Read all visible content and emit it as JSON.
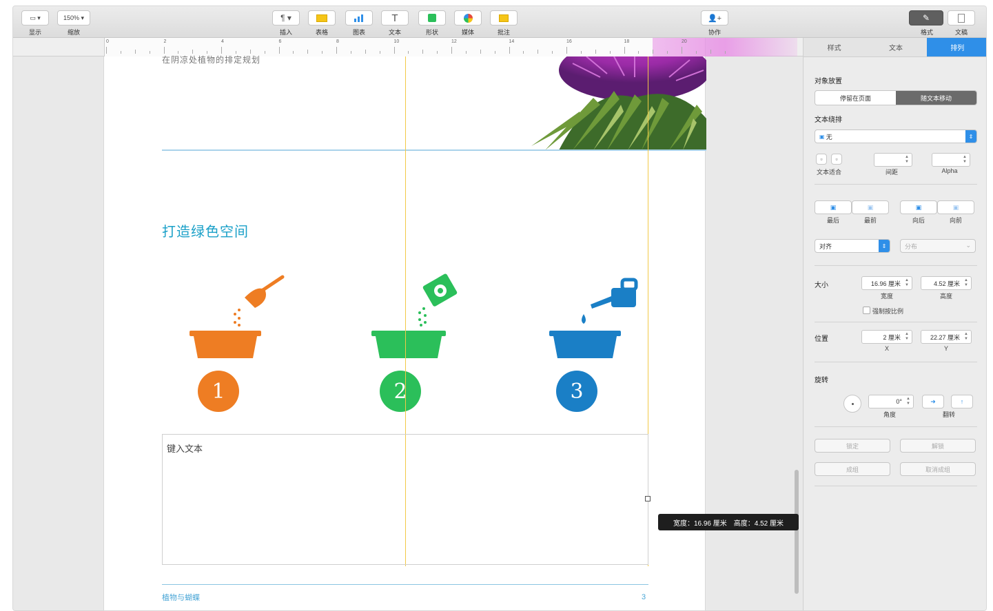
{
  "toolbar": {
    "view_label": "显示",
    "zoom_value": "150%",
    "zoom_label": "缩放",
    "insert_label": "插入",
    "table_label": "表格",
    "chart_label": "图表",
    "text_label": "文本",
    "shape_label": "形状",
    "media_label": "媒体",
    "comment_label": "批注",
    "collab_label": "协作",
    "format_label": "格式",
    "document_label": "文稿"
  },
  "ruler": {
    "numbers": [
      "0",
      "2",
      "4",
      "6",
      "8",
      "10",
      "12",
      "14",
      "16",
      "18",
      "20"
    ]
  },
  "document": {
    "cut_text": "在阴凉处植物的排定规划",
    "heading": "打造绿色空间",
    "steps": [
      {
        "number": "1",
        "color": "#ee7d23"
      },
      {
        "number": "2",
        "color": "#2bbf5a"
      },
      {
        "number": "3",
        "color": "#1a7fc6"
      }
    ],
    "textbox_placeholder": "键入文本",
    "footer_left": "植物与蝴蝶",
    "footer_right": "3",
    "tooltip_width": "宽度：16.96 厘米",
    "tooltip_height": "高度：4.52 厘米"
  },
  "inspector": {
    "tabs": [
      "样式",
      "文本",
      "排列"
    ],
    "active_tab": "排列",
    "object_placement_label": "对象放置",
    "placement_options": [
      "停留在页面",
      "随文本移动"
    ],
    "placement_selected": "随文本移动",
    "text_wrap_label": "文本绕排",
    "text_wrap_value": "无",
    "text_fit_label": "文本适合",
    "spacing_label": "间距",
    "alpha_label": "Alpha",
    "back_label": "最后",
    "backward_label": "最前",
    "forward_label": "向后",
    "front_label": "向前",
    "align_value": "对齐",
    "distribute_value": "分布",
    "size_label": "大小",
    "width_value": "16.96 厘米",
    "width_label": "宽度",
    "height_value": "4.52 厘米",
    "height_label": "高度",
    "constrain_label": "强制按比例",
    "position_label": "位置",
    "x_value": "2 厘米",
    "x_label": "X",
    "y_value": "22.27 厘米",
    "y_label": "Y",
    "rotate_label": "旋转",
    "angle_value": "0°",
    "angle_label": "角度",
    "flip_label": "翻转",
    "lock_label": "锁定",
    "unlock_label": "解锁",
    "group_label": "成组",
    "ungroup_label": "取消成组",
    "accent_color": "#2f8fe8"
  }
}
